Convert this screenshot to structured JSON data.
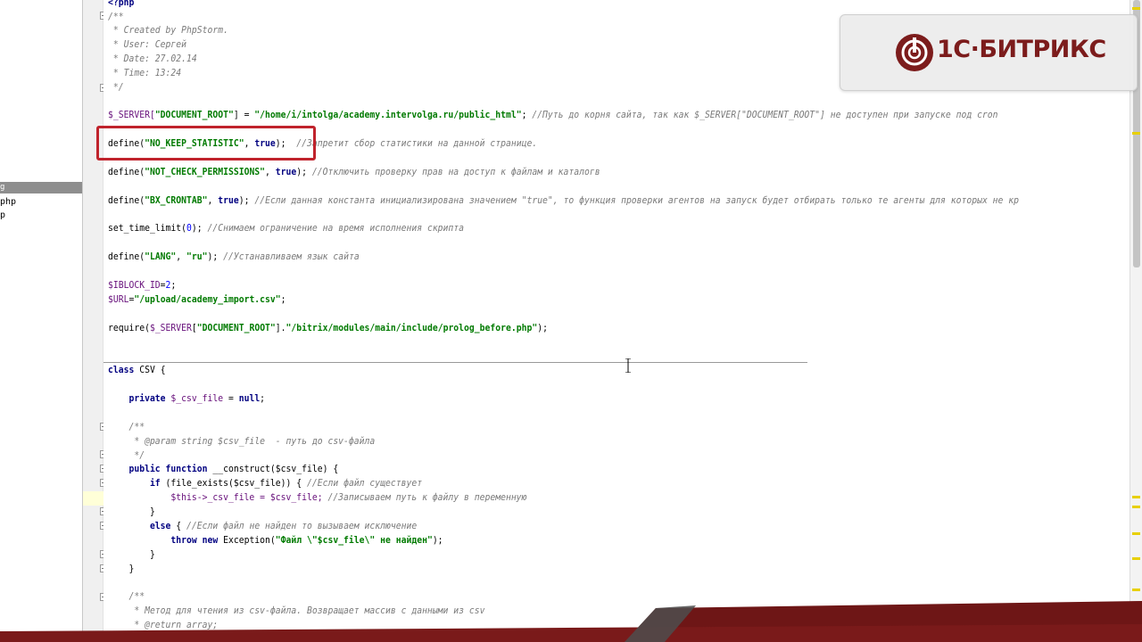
{
  "project_panel": {
    "selected_item": "g",
    "items": [
      "php",
      "p"
    ]
  },
  "editor": {
    "lines": [
      {
        "y": 0,
        "html_key": "l01"
      },
      {
        "y": 0,
        "html_key": "l02"
      }
    ],
    "code": {
      "l01": "<?php",
      "l02": "/**",
      "l03": " * Created by PhpStorm.",
      "l04": " * User: Сергей",
      "l05": " * Date: 27.02.14",
      "l06": " * Time: 13:24",
      "l07": " */",
      "l08_a": "$_SERVER[",
      "l08_b": "\"DOCUMENT_ROOT\"",
      "l08_c": "] = ",
      "l08_d": "\"/home/i/intolga/academy.intervolga.ru/public_html\"",
      "l08_e": "; ",
      "l08_f": "//Путь до корня сайта, так как $_SERVER[\"DOCUMENT_ROOT\"] не доступен при запуске под cron",
      "l09_a": "define(",
      "l09_b": "\"NO_KEEP_STATISTIC\"",
      "l09_c": ", ",
      "l09_d": "true",
      "l09_e": ");  ",
      "l09_f": "//Запретит сбор статистики на данной странице.",
      "l10_a": "define(",
      "l10_b": "\"NOT_CHECK_PERMISSIONS\"",
      "l10_c": ", ",
      "l10_d": "true",
      "l10_e": "); ",
      "l10_f": "//Отключить проверку прав на доступ к файлам и каталогв",
      "l11_a": "define(",
      "l11_b": "\"BX_CRONTAB\"",
      "l11_c": ", ",
      "l11_d": "true",
      "l11_e": "); ",
      "l11_f": "//Если данная константа инициализирована значением \"true\", то функция проверки агентов на запуск будет отбирать только те агенты для которых не кр",
      "l12_a": "set_time_limit(",
      "l12_b": "0",
      "l12_c": "); ",
      "l12_d": "//Снимаем ограничение на время исполнения скрипта",
      "l13_a": "define(",
      "l13_b": "\"LANG\"",
      "l13_c": ", ",
      "l13_d": "\"ru\"",
      "l13_e": "); ",
      "l13_f": "//Устанавливаем язык сайта",
      "l14_a": "$IBLOCK_ID",
      "l14_b": "=",
      "l14_c": "2",
      "l14_d": ";",
      "l15_a": "$URL",
      "l15_b": "=",
      "l15_c": "\"/upload/academy_import.csv\"",
      "l15_d": ";",
      "l16_a": "require(",
      "l16_b": "$_SERVER",
      "l16_c": "[",
      "l16_d": "\"DOCUMENT_ROOT\"",
      "l16_e": "].",
      "l16_f": "\"/bitrix/modules/main/include/prolog_before.php\"",
      "l16_g": ");",
      "l17_a": "class ",
      "l17_b": "CSV {",
      "l18_a": "    private ",
      "l18_b": "$_csv_file",
      "l18_c": " = ",
      "l18_d": "null",
      "l18_e": ";",
      "l19": "    /**",
      "l20": "     * @param string $csv_file  - путь до csv-файла",
      "l21": "     */",
      "l22_a": "    public function ",
      "l22_b": "__construct($csv_file) {",
      "l23_a": "        if ",
      "l23_b": "(file_exists($csv_file)) { ",
      "l23_c": "//Если файл существует",
      "l24_a": "            $this->_csv_file = $csv_file; ",
      "l24_b": "//Записываем путь к файлу в переменную",
      "l25": "        }",
      "l26_a": "        else ",
      "l26_b": "{ ",
      "l26_c": "//Если файл не найден то вызываем исключение",
      "l27_a": "            throw new ",
      "l27_b": "Exception(",
      "l27_c": "\"Файл \\\"$csv_file\\\" не найден\"",
      "l27_d": ");",
      "l28": "        }",
      "l29": "    }",
      "l30": "    /**",
      "l31": "     * Метод для чтения из csv-файла. Возвращает массив с данными из csv",
      "l32": "     * @return array;"
    }
  },
  "logo": {
    "text": "1С·БИТРИКС"
  },
  "colors": {
    "brand": "#7c1c1c",
    "highlight_box": "#c0232c",
    "current_line": "#ffffd8",
    "bottom_band": "#6e1616"
  }
}
